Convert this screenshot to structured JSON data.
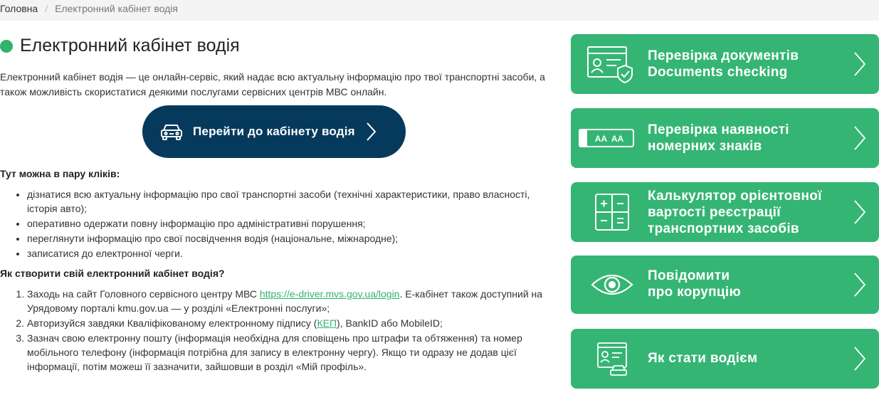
{
  "breadcrumb": {
    "home": "Головна",
    "separator": "/",
    "current": "Електронний кабінет водія"
  },
  "page": {
    "title": "Електронний кабінет водія",
    "intro": "Електронний кабінет водія — це онлайн-сервіс, який надає всю актуальну інформацію про твої транспортні засоби, а також можливість скористатися деякими послугами сервісних центрів МВС онлайн.",
    "cta_label": "Перейти до кабінету водія",
    "features_heading": "Тут можна в пару кліків:",
    "features": [
      "дізнатися всю актуальну інформацію про свої транспортні засоби (технічні характеристики, право власності, історія авто);",
      "оперативно одержати повну інформацію про адміністративні порушення;",
      "переглянути інформацію про свої посвідчення водія (національне, міжнародне);",
      "записатися до електронної черги."
    ],
    "howto_heading": "Як створити свій електронний кабінет водія?",
    "steps": {
      "s1_a": "Заходь на сайт Головного сервісного центру МВС ",
      "s1_link": "https://e-driver.mvs.gov.ua/login",
      "s1_b": ". Е-кабінет також доступний на Урядовому порталі kmu.gov.ua — у розділі «Електронні послуги»;",
      "s2_a": "Авторизуйся завдяки Кваліфікованому електронному  підпису (",
      "s2_link": "КЕП",
      "s2_b": "), BankID або MobileID;",
      "s3": "Зазнач свою електронну пошту (інформація необхідна для сповіщень про штрафи та обтяження) та номер мобільного телефону (інформація потрібна для запису в електронну чергу). Якщо ти одразу не додав цієї інформації, потім можеш її зазначити, зайшовши в розділ «Мій профіль»."
    }
  },
  "sidebar": {
    "cards": [
      {
        "line1": "Перевірка документів",
        "line2": "Documents checking",
        "line3": "",
        "icon": "id-card-shield-icon"
      },
      {
        "line1": "Перевірка наявності",
        "line2": "номерних знаків",
        "line3": "",
        "icon": "license-plate-icon",
        "plate_text": "AA  AA"
      },
      {
        "line1": "Калькулятор орієнтовної",
        "line2": "вартості реєстрації",
        "line3": "транспортних засобів",
        "icon": "calculator-icon"
      },
      {
        "line1": "Повідомити",
        "line2": "про корупцію",
        "line3": "",
        "icon": "eye-icon"
      },
      {
        "line1": "Як стати водієм",
        "line2": "",
        "line3": "",
        "icon": "driver-license-icon"
      }
    ]
  },
  "colors": {
    "accent_green": "#35b574",
    "dot_green": "#2fb36d",
    "cta_navy": "#063a5c"
  }
}
